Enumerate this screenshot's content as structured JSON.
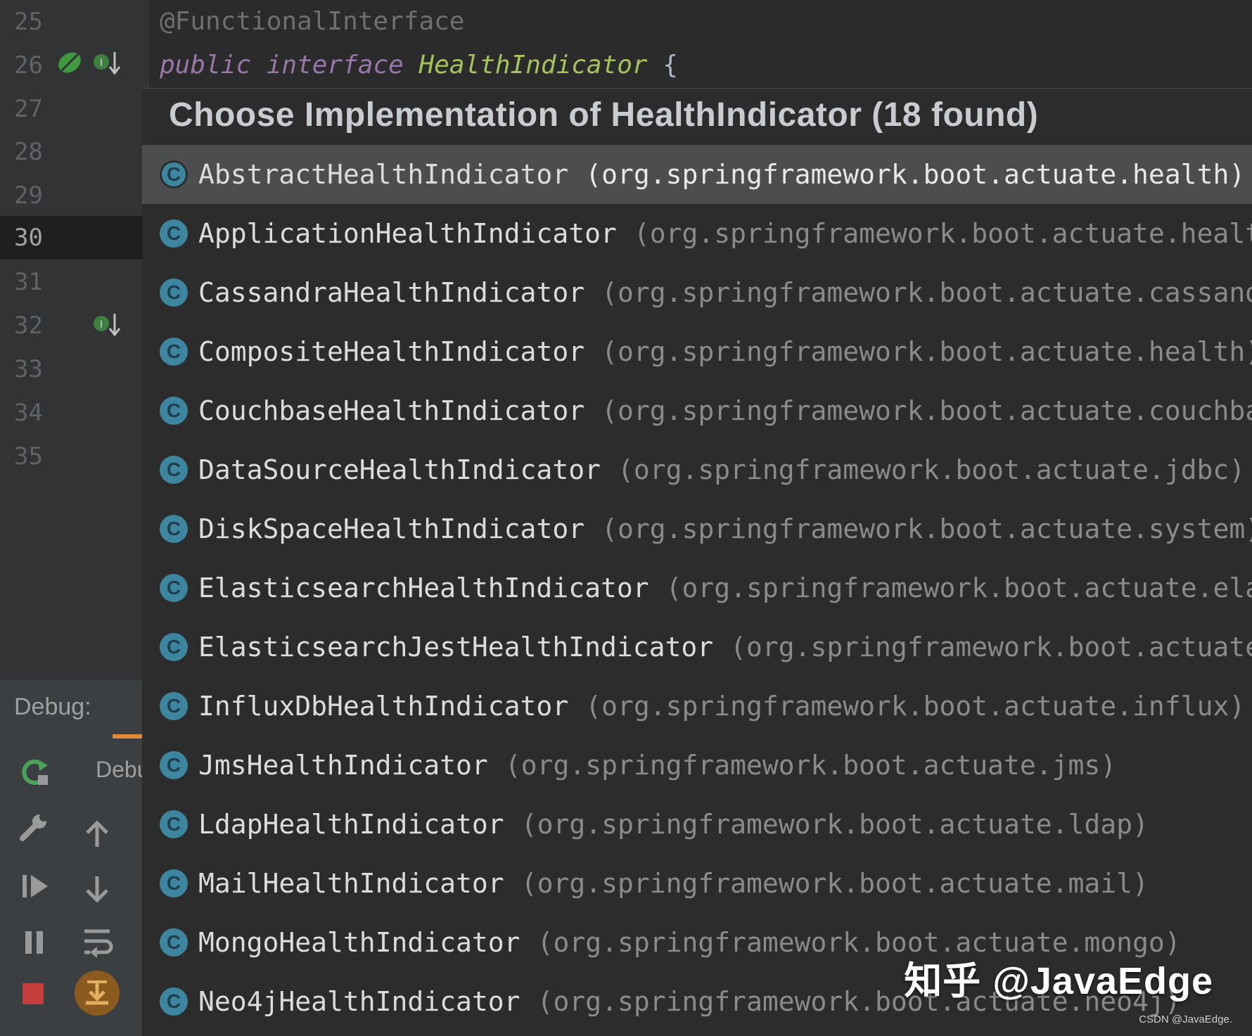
{
  "gutter": {
    "lines": [
      "25",
      "26",
      "27",
      "28",
      "29",
      "30",
      "31",
      "32",
      "33",
      "34",
      "35"
    ],
    "active_line": "30"
  },
  "editor": {
    "line25": "@FunctionalInterface",
    "line26_kw1": "public",
    "line26_kw2": "interface",
    "line26_type": "HealthIndicator",
    "line26_brace": "{"
  },
  "popup": {
    "title": "Choose Implementation of HealthIndicator (18 found)",
    "items": [
      {
        "name": "AbstractHealthIndicator",
        "pkg": "(org.springframework.boot.actuate.health)",
        "selected": true,
        "abstract": true
      },
      {
        "name": "ApplicationHealthIndicator",
        "pkg": "(org.springframework.boot.actuate.health)"
      },
      {
        "name": "CassandraHealthIndicator",
        "pkg": "(org.springframework.boot.actuate.cassandra)"
      },
      {
        "name": "CompositeHealthIndicator",
        "pkg": "(org.springframework.boot.actuate.health)"
      },
      {
        "name": "CouchbaseHealthIndicator",
        "pkg": "(org.springframework.boot.actuate.couchbase)"
      },
      {
        "name": "DataSourceHealthIndicator",
        "pkg": "(org.springframework.boot.actuate.jdbc)"
      },
      {
        "name": "DiskSpaceHealthIndicator",
        "pkg": "(org.springframework.boot.actuate.system)"
      },
      {
        "name": "ElasticsearchHealthIndicator",
        "pkg": "(org.springframework.boot.actuate.elasti"
      },
      {
        "name": "ElasticsearchJestHealthIndicator",
        "pkg": "(org.springframework.boot.actuate.el"
      },
      {
        "name": "InfluxDbHealthIndicator",
        "pkg": "(org.springframework.boot.actuate.influx)"
      },
      {
        "name": "JmsHealthIndicator",
        "pkg": "(org.springframework.boot.actuate.jms)"
      },
      {
        "name": "LdapHealthIndicator",
        "pkg": "(org.springframework.boot.actuate.ldap)"
      },
      {
        "name": "MailHealthIndicator",
        "pkg": "(org.springframework.boot.actuate.mail)"
      },
      {
        "name": "MongoHealthIndicator",
        "pkg": "(org.springframework.boot.actuate.mongo)"
      },
      {
        "name": "Neo4jHealthIndicator",
        "pkg": "(org.springframework.boot.actuate.neo4j)"
      }
    ],
    "class_icon_letter": "C"
  },
  "debug": {
    "label": "Debug:",
    "session": "Debu"
  },
  "watermark": {
    "main": "知乎 @JavaEdge",
    "small": "CSDN @JavaEdge."
  },
  "colors": {
    "class_icon": "#3e86a0",
    "selection": "#4b4d4f",
    "tab_underline": "#e08a3a",
    "stop": "#c43e3e"
  }
}
